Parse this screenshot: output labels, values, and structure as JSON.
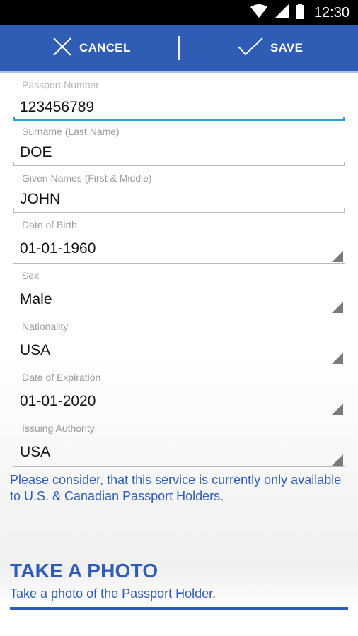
{
  "status_bar": {
    "time": "12:30",
    "icons": [
      "wifi-icon",
      "signal-icon",
      "battery-icon"
    ]
  },
  "action_bar": {
    "cancel_label": "CANCEL",
    "save_label": "SAVE",
    "color": "#2f5db5"
  },
  "form": {
    "passport_number": {
      "label": "Passport Number",
      "value": "123456789"
    },
    "surname": {
      "label": "Surname (Last Name)",
      "value": "DOE"
    },
    "given_names": {
      "label": "Given Names (First & Middle)",
      "value": "JOHN"
    },
    "date_of_birth": {
      "label": "Date of Birth",
      "value": "01-01-1960"
    },
    "sex": {
      "label": "Sex",
      "value": "Male"
    },
    "nationality": {
      "label": "Nationality",
      "value": "USA"
    },
    "date_of_expiration": {
      "label": "Date of Expiration",
      "value": "01-01-2020"
    },
    "issuing_authority": {
      "label": "Issuing Authority",
      "value": "USA"
    }
  },
  "notice": "Please consider, that this service is currently only available to U.S. & Canadian Passport Holders.",
  "photo_section": {
    "title": "TAKE A PHOTO",
    "subtitle": "Take a photo of the Passport Holder."
  }
}
